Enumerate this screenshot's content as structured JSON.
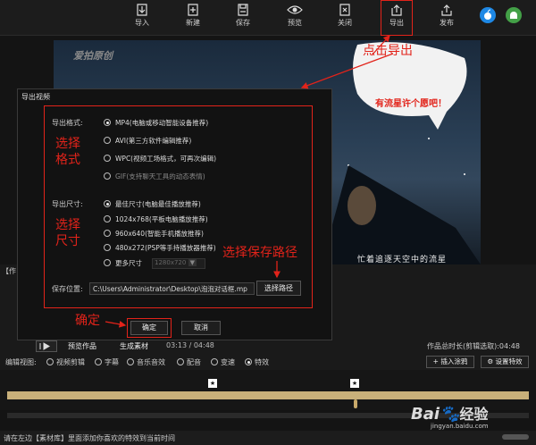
{
  "toolbar": {
    "import": "导入",
    "new": "新建",
    "save": "保存",
    "preview": "预览",
    "close": "关闭",
    "export": "导出",
    "publish": "发布"
  },
  "canvas": {
    "watermark": "爱拍原创",
    "bubble_text": "有流星许个愿吧！",
    "poem": "忙着追逐天空中的流星"
  },
  "dialog": {
    "title": "导出视频",
    "format_label": "导出格式:",
    "formats": [
      {
        "text": "MP4(电脑或移动智能设备推荐)",
        "selected": true,
        "disabled": false
      },
      {
        "text": "AVI(第三方软件编辑推荐)",
        "selected": false,
        "disabled": false
      },
      {
        "text": "WPC(视频工场格式，可再次编辑)",
        "selected": false,
        "disabled": false
      },
      {
        "text": "GIF(支持聊天工具的动态表情)",
        "selected": false,
        "disabled": true
      }
    ],
    "size_label": "导出尺寸:",
    "sizes": [
      {
        "text": "最佳尺寸(电脑最佳播放推荐)",
        "selected": true
      },
      {
        "text": "1024x768(平板电脑播放推荐)",
        "selected": false
      },
      {
        "text": "960x640(智能手机播放推荐)",
        "selected": false
      },
      {
        "text": "480x272(PSP等手持播放器推荐)",
        "selected": false
      }
    ],
    "more_sizes": "更多尺寸",
    "more_sizes_value": "1280x720",
    "save_label": "保存位置:",
    "save_path": "C:\\Users\\Administrator\\Desktop\\泡泡对话框.mp",
    "choose_path": "选择路径",
    "ok": "确定",
    "cancel": "取消"
  },
  "annotations": {
    "click_export": "点击导出",
    "choose_format_1": "选择",
    "choose_format_2": "格式",
    "choose_size_1": "选择",
    "choose_size_2": "尺寸",
    "choose_path": "选择保存路径",
    "confirm": "确定",
    "color": "#e2231a"
  },
  "controls": {
    "preview_work": "预览作品",
    "generate_material": "生成素材",
    "time": "03:13 / 04:48",
    "total_length": "作品总时长(剪辑选取):04:48"
  },
  "view": {
    "label": "编辑视图:",
    "options": [
      {
        "text": "视频剪辑",
        "selected": false
      },
      {
        "text": "字幕",
        "selected": false
      },
      {
        "text": "音乐音效",
        "selected": false
      },
      {
        "text": "配音",
        "selected": false
      },
      {
        "text": "变速",
        "selected": false
      },
      {
        "text": "特效",
        "selected": true
      }
    ],
    "insert_doodle": "插入涂鸦",
    "set_effect": "设置特效"
  },
  "left_label": "【作",
  "status": "请在左边【素材库】里面添加你喜欢的特效到当前时间",
  "baidu": {
    "brand": "Bai",
    "suffix": "经验",
    "url": "jingyan.baidu.com"
  }
}
